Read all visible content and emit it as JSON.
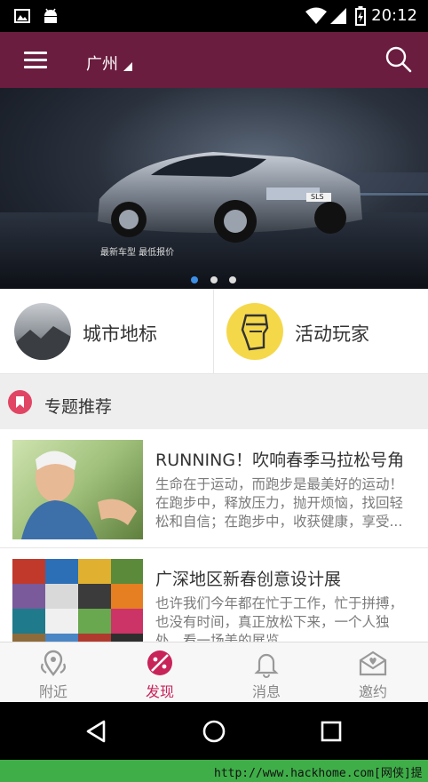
{
  "status_bar": {
    "time": "20:12"
  },
  "app_bar": {
    "city": "广州"
  },
  "banner": {
    "caption": "最新车型  最低报价",
    "plate": "SLS",
    "dots": 3,
    "active_dot": 0
  },
  "categories": [
    {
      "label": "城市地标",
      "icon": "landmark-photo"
    },
    {
      "label": "活动玩家",
      "icon": "mask-icon"
    }
  ],
  "section": {
    "title": "专题推荐",
    "icon": "bookmark-icon"
  },
  "list": [
    {
      "title": "RUNNING！吹响春季马拉松号角",
      "desc": "生命在于运动，而跑步是最美好的运动！在跑步中，释放压力，抛开烦恼，找回轻松和自信；在跑步中，收获健康，享受..."
    },
    {
      "title": "广深地区新春创意设计展",
      "desc": "也许我们今年都在忙于工作，忙于拼搏，也没有时间，真正放松下来，一个人独处，看一场美的展览。"
    }
  ],
  "bottom_nav": [
    {
      "label": "附近",
      "icon": "location-icon",
      "active": false
    },
    {
      "label": "发现",
      "icon": "discover-icon",
      "active": true
    },
    {
      "label": "消息",
      "icon": "bell-icon",
      "active": false
    },
    {
      "label": "邀约",
      "icon": "invite-mail-icon",
      "active": false
    }
  ],
  "footer": {
    "text": "http://www.hackhome.com[网侠]提供"
  },
  "colors": {
    "primary": "#6b1d3f",
    "accent": "#c8245a",
    "footer": "#3fae48"
  }
}
